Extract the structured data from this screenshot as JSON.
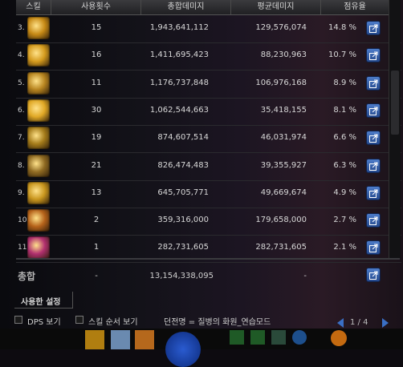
{
  "header": {
    "col_skill": "스킬",
    "col_count": "사용횟수",
    "col_total": "총합데미지",
    "col_avg": "평균데미지",
    "col_pct": "점유율"
  },
  "rows": [
    {
      "rank": "3.",
      "count": "15",
      "total": "1,943,641,112",
      "avg": "129,576,074",
      "pct": "14.8  %",
      "icon_color": "#c78a16"
    },
    {
      "rank": "4.",
      "count": "16",
      "total": "1,411,695,423",
      "avg": "88,230,963",
      "pct": "10.7  %",
      "icon_color": "#d59b1e"
    },
    {
      "rank": "5.",
      "count": "11",
      "total": "1,176,737,848",
      "avg": "106,976,168",
      "pct": "8.9  %",
      "icon_color": "#b88520"
    },
    {
      "rank": "6.",
      "count": "30",
      "total": "1,062,544,663",
      "avg": "35,418,155",
      "pct": "8.1  %",
      "icon_color": "#e0a825"
    },
    {
      "rank": "7.",
      "count": "19",
      "total": "874,607,514",
      "avg": "46,031,974",
      "pct": "6.6  %",
      "icon_color": "#a47b1a"
    },
    {
      "rank": "8.",
      "count": "21",
      "total": "826,474,483",
      "avg": "39,355,927",
      "pct": "6.3  %",
      "icon_color": "#8f6a22"
    },
    {
      "rank": "9.",
      "count": "13",
      "total": "645,705,771",
      "avg": "49,669,674",
      "pct": "4.9  %",
      "icon_color": "#c9961e"
    },
    {
      "rank": "10.",
      "count": "2",
      "total": "359,316,000",
      "avg": "179,658,000",
      "pct": "2.7  %",
      "icon_color": "#b5621a"
    },
    {
      "rank": "11.",
      "count": "1",
      "total": "282,731,605",
      "avg": "282,731,605",
      "pct": "2.1  %",
      "icon_color": "#b1306f"
    }
  ],
  "totals": {
    "label": "총합",
    "count": "-",
    "total": "13,154,338,095",
    "avg": "-"
  },
  "settings_label": "사용한 설정",
  "bottom": {
    "dps_label": "DPS 보기",
    "order_label": "스킬 순서 보기",
    "dungeon_text": "던전명 = 질병의 화원_연습모드",
    "page": "1 / 4"
  },
  "colors": {
    "accent": "#3a6fc4"
  }
}
